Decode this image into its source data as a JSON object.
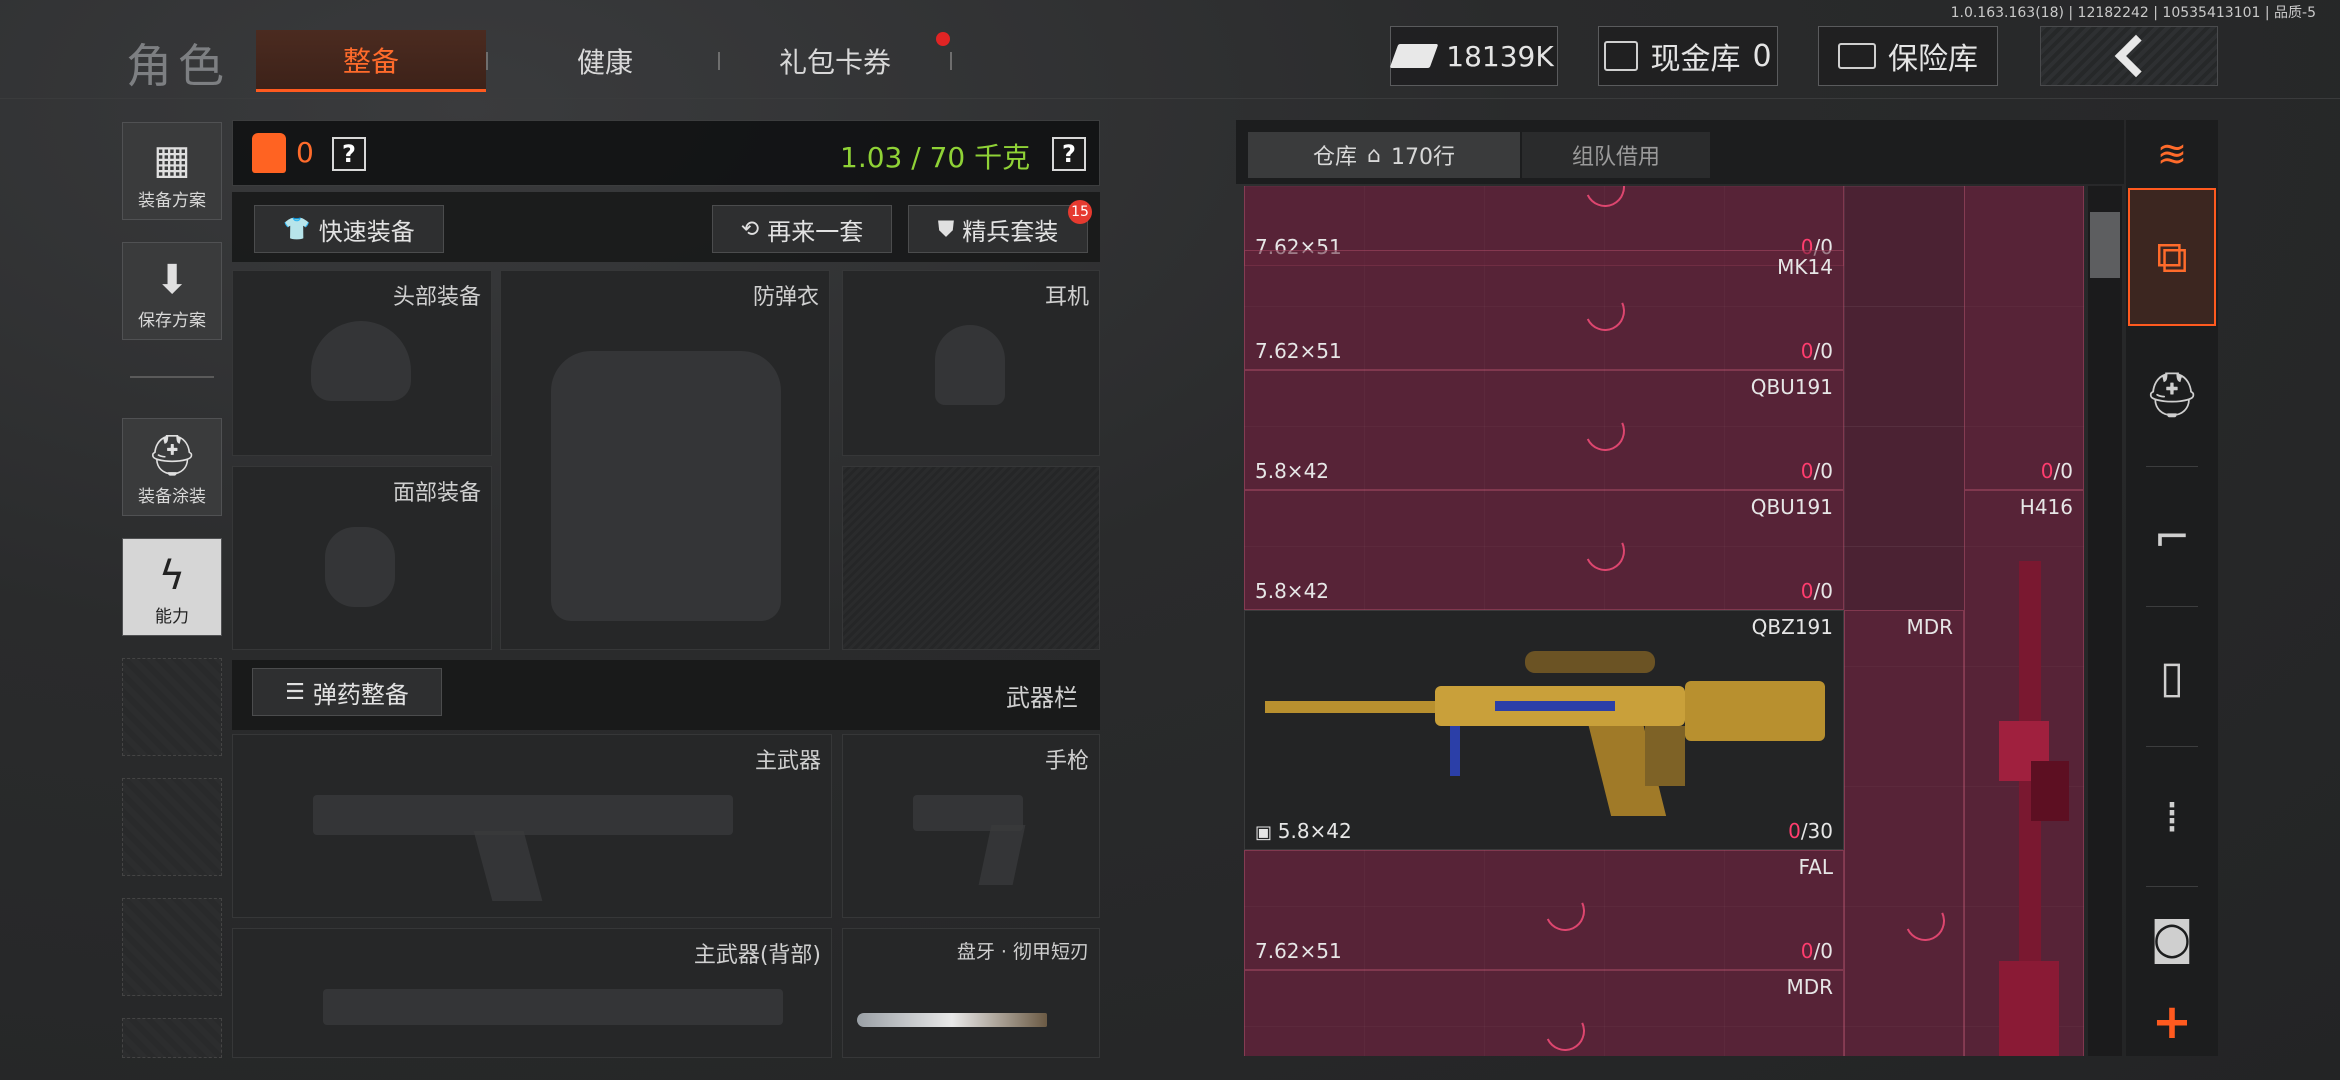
{
  "version": "1.0.163.163(18) | 12182242 | 10535413101 | 品质-5",
  "header": {
    "title": "角色",
    "tabs": [
      {
        "label": "整备",
        "active": true
      },
      {
        "label": "健康",
        "active": false
      },
      {
        "label": "礼包卡券",
        "active": false,
        "has_notification": true
      }
    ],
    "currency": "18139K",
    "cash_vault_label": "现金库",
    "cash_vault_value": "0",
    "safe_label": "保险库"
  },
  "sidebar": {
    "items": [
      {
        "label": "装备方案",
        "icon": "armor-vest-icon"
      },
      {
        "label": "保存方案",
        "icon": "download-icon"
      },
      {
        "label": "装备涂装",
        "icon": "helmet-paint-icon"
      },
      {
        "label": "能力",
        "icon": "ability-bolt-icon",
        "active": true
      }
    ]
  },
  "loadout": {
    "armor_count": "0",
    "weight": "1.03 / 70 千克",
    "help": "?",
    "quick_equip": "快速装备",
    "repeat_set": "再来一套",
    "elite_set": "精兵套装",
    "elite_badge": "15",
    "slots": {
      "head": "头部装备",
      "armor": "防弹衣",
      "headset": "耳机",
      "face": "面部装备",
      "ammo_button": "弹药整备",
      "weapon_bar": "武器栏",
      "primary": "主武器",
      "pistol": "手枪",
      "primary_back": "主武器(背部)",
      "melee": "盘牙 · 彻甲短刃"
    }
  },
  "warehouse": {
    "tab_storage": "仓库",
    "rows": "170行",
    "tab_team": "组队借用",
    "items": [
      {
        "name": "",
        "caliber": "7.62×51",
        "ammo_cur": "0",
        "ammo_max": "/0"
      },
      {
        "name": "MK14",
        "caliber": "7.62×51",
        "ammo_cur": "0",
        "ammo_max": "/0"
      },
      {
        "name": "QBU191",
        "caliber": "5.8×42",
        "ammo_cur": "0",
        "ammo_max": "/0"
      },
      {
        "name": "QBU191",
        "caliber": "5.8×42",
        "ammo_cur": "0",
        "ammo_max": "/0"
      },
      {
        "name": "QBZ191",
        "caliber": "5.8×42",
        "ammo_cur": "0",
        "ammo_max": "/30"
      },
      {
        "name": "FAL",
        "caliber": "7.62×51",
        "ammo_cur": "0",
        "ammo_max": "/0"
      },
      {
        "name": "MDR",
        "caliber": "",
        "ammo_cur": "",
        "ammo_max": ""
      }
    ],
    "side_items": [
      {
        "name": "",
        "ammo_cur": "0",
        "ammo_max": "/0"
      },
      {
        "name": "H416"
      },
      {
        "name": "MDR"
      }
    ]
  },
  "colors": {
    "accent": "#ff5a1f",
    "weight_green": "#8fd236",
    "grid_bg": "#4b2233",
    "ammo_red": "#ff3d6e"
  }
}
